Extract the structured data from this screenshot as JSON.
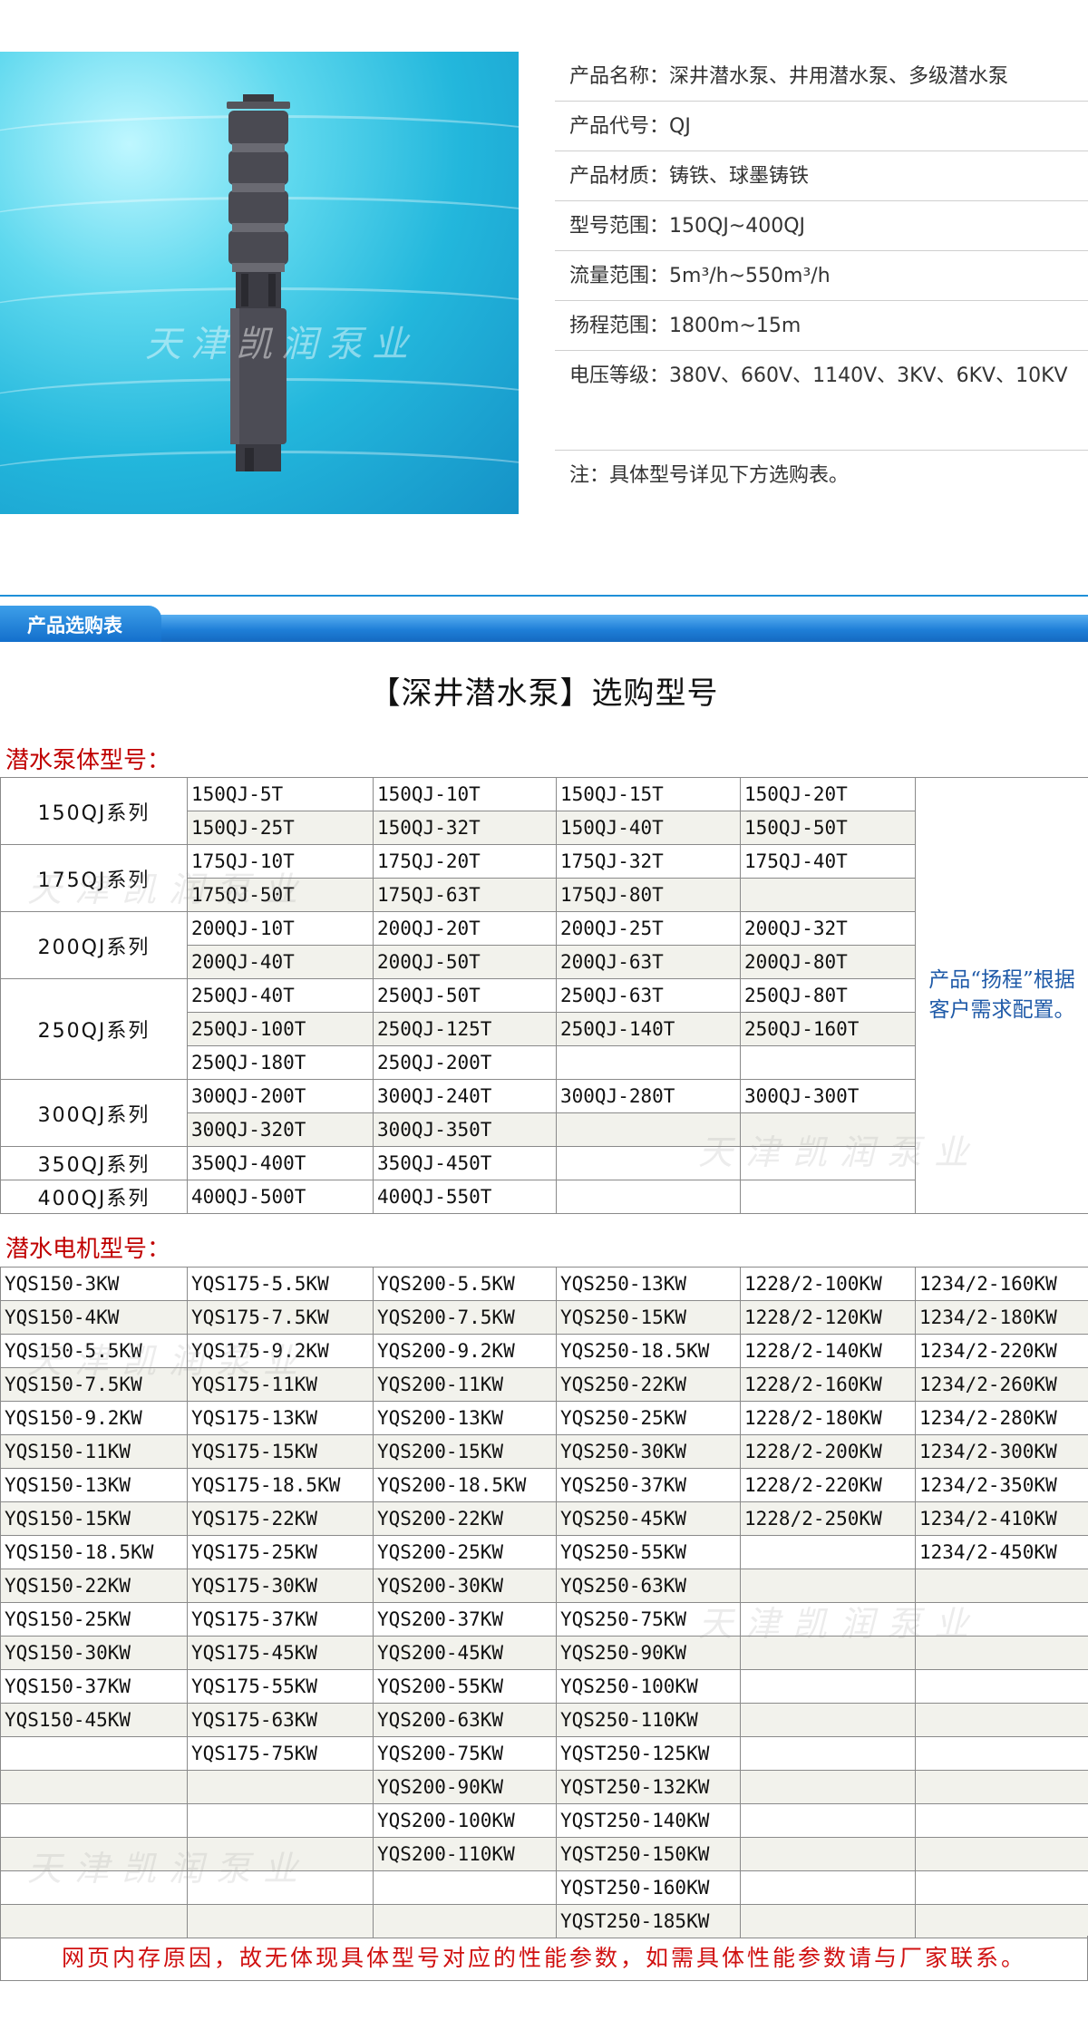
{
  "hero": {
    "watermark": "天津凯润泵业"
  },
  "specs": [
    {
      "label": "产品名称：",
      "value": "深井潜水泵、井用潜水泵、多级潜水泵"
    },
    {
      "label": "产品代号：",
      "value": "QJ"
    },
    {
      "label": "产品材质：",
      "value": "铸铁、球墨铸铁"
    },
    {
      "label": "型号范围：",
      "value": "150QJ~400QJ"
    },
    {
      "label": "流量范围：",
      "value": "5m³/h~550m³/h"
    },
    {
      "label": "扬程范围：",
      "value": "1800m~15m"
    },
    {
      "label": "电压等级：",
      "value": "380V、660V、1140V、3KV、6KV、10KV"
    },
    {
      "label": "注：",
      "value": "具体型号详见下方选购表。"
    }
  ],
  "section_title": "产品选购表",
  "main_title": "【深井潜水泵】选购型号",
  "pump_caption": "潜水泵体型号：",
  "pump_note": "产品“扬程”根据客户需求配置。",
  "pump_groups": [
    {
      "series": "150QJ系列",
      "rows": [
        [
          "150QJ-5T",
          "150QJ-10T",
          "150QJ-15T",
          "150QJ-20T"
        ],
        [
          "150QJ-25T",
          "150QJ-32T",
          "150QJ-40T",
          "150QJ-50T"
        ]
      ]
    },
    {
      "series": "175QJ系列",
      "rows": [
        [
          "175QJ-10T",
          "175QJ-20T",
          "175QJ-32T",
          "175QJ-40T"
        ],
        [
          "175QJ-50T",
          "175QJ-63T",
          "175QJ-80T",
          ""
        ]
      ]
    },
    {
      "series": "200QJ系列",
      "rows": [
        [
          "200QJ-10T",
          "200QJ-20T",
          "200QJ-25T",
          "200QJ-32T"
        ],
        [
          "200QJ-40T",
          "200QJ-50T",
          "200QJ-63T",
          "200QJ-80T"
        ]
      ]
    },
    {
      "series": "250QJ系列",
      "rows": [
        [
          "250QJ-40T",
          "250QJ-50T",
          "250QJ-63T",
          "250QJ-80T"
        ],
        [
          "250QJ-100T",
          "250QJ-125T",
          "250QJ-140T",
          "250QJ-160T"
        ],
        [
          "250QJ-180T",
          "250QJ-200T",
          "",
          ""
        ]
      ]
    },
    {
      "series": "300QJ系列",
      "rows": [
        [
          "300QJ-200T",
          "300QJ-240T",
          "300QJ-280T",
          "300QJ-300T"
        ],
        [
          "300QJ-320T",
          "300QJ-350T",
          "",
          ""
        ]
      ]
    },
    {
      "series": "350QJ系列",
      "rows": [
        [
          "350QJ-400T",
          "350QJ-450T",
          "",
          ""
        ]
      ]
    },
    {
      "series": "400QJ系列",
      "rows": [
        [
          "400QJ-500T",
          "400QJ-550T",
          "",
          ""
        ]
      ]
    }
  ],
  "motor_caption": "潜水电机型号：",
  "motor_rows": [
    [
      "YQS150-3KW",
      "YQS175-5.5KW",
      "YQS200-5.5KW",
      "YQS250-13KW",
      "1228/2-100KW",
      "1234/2-160KW"
    ],
    [
      "YQS150-4KW",
      "YQS175-7.5KW",
      "YQS200-7.5KW",
      "YQS250-15KW",
      "1228/2-120KW",
      "1234/2-180KW"
    ],
    [
      "YQS150-5.5KW",
      "YQS175-9.2KW",
      "YQS200-9.2KW",
      "YQS250-18.5KW",
      "1228/2-140KW",
      "1234/2-220KW"
    ],
    [
      "YQS150-7.5KW",
      "YQS175-11KW",
      "YQS200-11KW",
      "YQS250-22KW",
      "1228/2-160KW",
      "1234/2-260KW"
    ],
    [
      "YQS150-9.2KW",
      "YQS175-13KW",
      "YQS200-13KW",
      "YQS250-25KW",
      "1228/2-180KW",
      "1234/2-280KW"
    ],
    [
      "YQS150-11KW",
      "YQS175-15KW",
      "YQS200-15KW",
      "YQS250-30KW",
      "1228/2-200KW",
      "1234/2-300KW"
    ],
    [
      "YQS150-13KW",
      "YQS175-18.5KW",
      "YQS200-18.5KW",
      "YQS250-37KW",
      "1228/2-220KW",
      "1234/2-350KW"
    ],
    [
      "YQS150-15KW",
      "YQS175-22KW",
      "YQS200-22KW",
      "YQS250-45KW",
      "1228/2-250KW",
      "1234/2-410KW"
    ],
    [
      "YQS150-18.5KW",
      "YQS175-25KW",
      "YQS200-25KW",
      "YQS250-55KW",
      "",
      "1234/2-450KW"
    ],
    [
      "YQS150-22KW",
      "YQS175-30KW",
      "YQS200-30KW",
      "YQS250-63KW",
      "",
      ""
    ],
    [
      "YQS150-25KW",
      "YQS175-37KW",
      "YQS200-37KW",
      "YQS250-75KW",
      "",
      ""
    ],
    [
      "YQS150-30KW",
      "YQS175-45KW",
      "YQS200-45KW",
      "YQS250-90KW",
      "",
      ""
    ],
    [
      "YQS150-37KW",
      "YQS175-55KW",
      "YQS200-55KW",
      "YQS250-100KW",
      "",
      ""
    ],
    [
      "YQS150-45KW",
      "YQS175-63KW",
      "YQS200-63KW",
      "YQS250-110KW",
      "",
      ""
    ],
    [
      "",
      "YQS175-75KW",
      "YQS200-75KW",
      "YQST250-125KW",
      "",
      ""
    ],
    [
      "",
      "",
      "YQS200-90KW",
      "YQST250-132KW",
      "",
      ""
    ],
    [
      "",
      "",
      "YQS200-100KW",
      "YQST250-140KW",
      "",
      ""
    ],
    [
      "",
      "",
      "YQS200-110KW",
      "YQST250-150KW",
      "",
      ""
    ],
    [
      "",
      "",
      "",
      "YQST250-160KW",
      "",
      ""
    ],
    [
      "",
      "",
      "",
      "YQST250-185KW",
      "",
      ""
    ]
  ],
  "footer_note": "网页内存原因，故无体现具体型号对应的性能参数，如需具体性能参数请与厂家联系。",
  "watermark_text": "天津凯润泵业"
}
